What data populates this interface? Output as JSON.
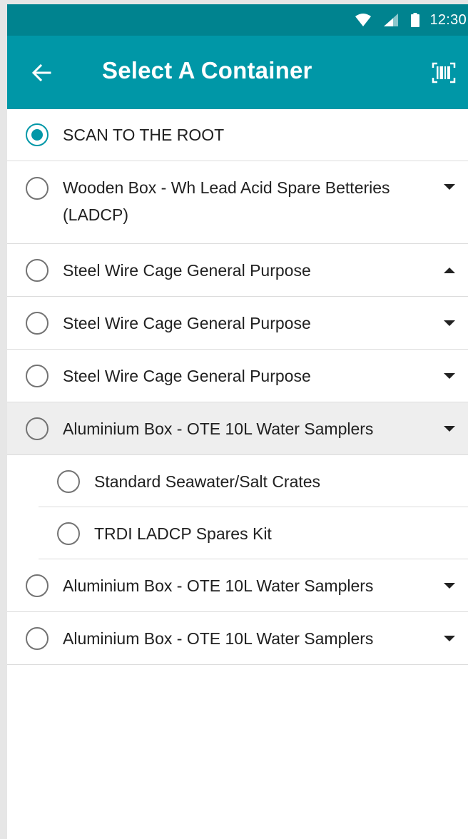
{
  "status_bar": {
    "time": "12:30"
  },
  "app_bar": {
    "title": "Select A Container",
    "back_icon": "arrow-back-icon",
    "scan_icon": "barcode-scan-icon"
  },
  "colors": {
    "primary": "#0097a7",
    "primary_dark": "#00838f",
    "radio_unchecked": "#737373",
    "row_highlight": "#eeeeee"
  },
  "items": [
    {
      "label": "SCAN TO THE ROOT",
      "selected": true,
      "caret": "none"
    },
    {
      "label": "Wooden Box - Wh Lead Acid Spare Betteries (LADCP)",
      "selected": false,
      "caret": "down"
    },
    {
      "label": "Steel Wire Cage General Purpose",
      "selected": false,
      "caret": "up"
    },
    {
      "label": "Steel Wire Cage General Purpose",
      "selected": false,
      "caret": "down"
    },
    {
      "label": "Steel Wire Cage General Purpose",
      "selected": false,
      "caret": "down"
    },
    {
      "label": "Aluminium Box - OTE 10L Water Samplers",
      "selected": false,
      "caret": "down",
      "expanded": true,
      "children": [
        {
          "label": "Standard Seawater/Salt Crates",
          "selected": false
        },
        {
          "label": "TRDI LADCP Spares Kit",
          "selected": false
        }
      ]
    },
    {
      "label": "Aluminium Box - OTE 10L Water Samplers",
      "selected": false,
      "caret": "down"
    },
    {
      "label": "Aluminium Box - OTE 10L Water Samplers",
      "selected": false,
      "caret": "down"
    }
  ]
}
